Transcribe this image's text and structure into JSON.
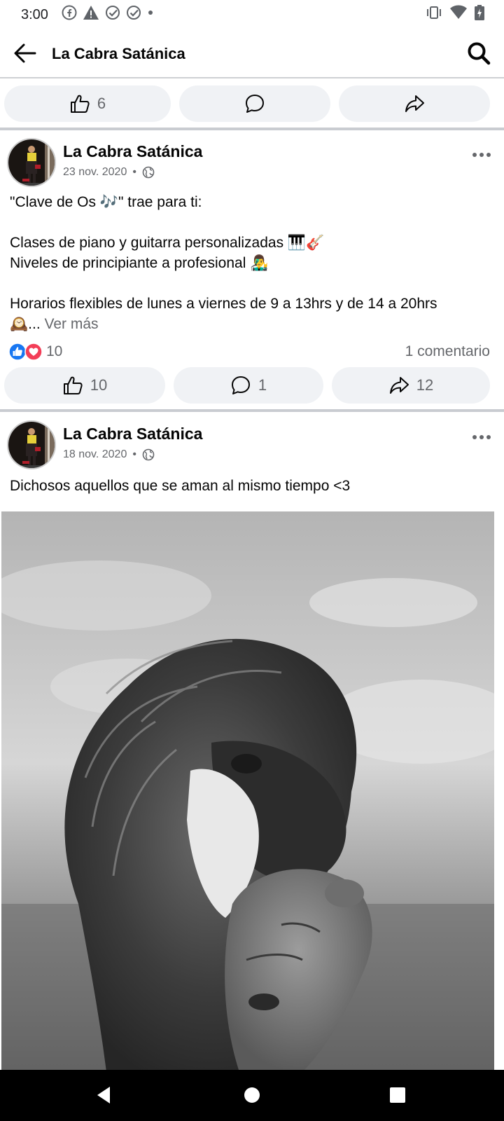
{
  "status_bar": {
    "time": "3:00",
    "left_icons": [
      "facebook-icon",
      "warning-icon",
      "check-circle-icon",
      "check-circle-icon",
      "dot-icon"
    ],
    "right_icons": [
      "vibrate-icon",
      "wifi-icon",
      "battery-charging-icon"
    ]
  },
  "app_bar": {
    "title": "La Cabra Satánica",
    "back_icon": "arrow-left-icon",
    "search_icon": "search-icon"
  },
  "previous_post": {
    "like_count": "6"
  },
  "posts": [
    {
      "author": "La Cabra Satánica",
      "date": "23 nov. 2020",
      "meta_separator": "•",
      "privacy_icon": "globe-icon",
      "text": "\"Clave de Os 🎶\" trae para ti:\n\nClases de piano y guitarra personalizadas 🎹🎸\nNiveles de principiante a profesional 👨‍🎤\n\nHorarios flexibles de lunes a viernes de 9 a 13hrs y de 14 a 20hrs\n🕰️... ",
      "see_more": "Ver más",
      "reaction_count": "10",
      "comments_label": "1 comentario",
      "like_count": "10",
      "comment_count": "1",
      "share_count": "12"
    },
    {
      "author": "La Cabra Satánica",
      "date": "18 nov. 2020",
      "meta_separator": "•",
      "privacy_icon": "globe-icon",
      "text": "Dichosos aquellos que se aman al mismo tiempo <3"
    }
  ],
  "colors": {
    "like_blue": "#1877f2",
    "love_red": "#f33e58",
    "secondary_text": "#65676b",
    "button_bg": "#f0f2f5",
    "separator": "#c9ccd1"
  },
  "nav_bar": {
    "icons": [
      "back-triangle-icon",
      "home-circle-icon",
      "recents-square-icon"
    ]
  }
}
